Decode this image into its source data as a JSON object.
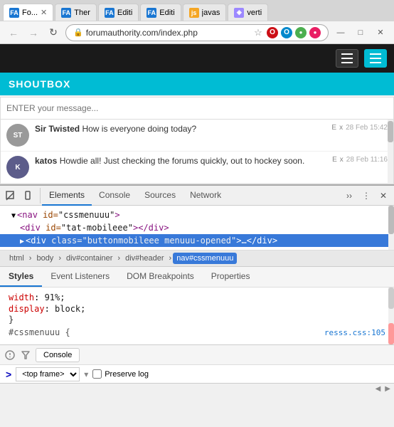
{
  "browser": {
    "tabs": [
      {
        "id": "tab1",
        "favicon": "FA",
        "favicon_style": "fa",
        "label": "Fo...",
        "active": true,
        "closeable": true
      },
      {
        "id": "tab2",
        "favicon": "FA",
        "favicon_style": "fa",
        "label": "Ther",
        "active": false,
        "closeable": false
      },
      {
        "id": "tab3",
        "favicon": "FA",
        "favicon_style": "fa",
        "label": "Editi",
        "active": false,
        "closeable": false
      },
      {
        "id": "tab4",
        "favicon": "FA",
        "favicon_style": "fa",
        "label": "Editi",
        "active": false,
        "closeable": false
      },
      {
        "id": "tab5",
        "favicon": "js",
        "favicon_style": "js",
        "label": "javas",
        "active": false,
        "closeable": false
      },
      {
        "id": "tab6",
        "favicon": "◈",
        "favicon_style": "vert",
        "label": "verti",
        "active": false,
        "closeable": false
      }
    ],
    "address": "forumauthority.com/index.php"
  },
  "site": {
    "header": {
      "hamburger1_label": "≡",
      "hamburger2_label": "≡"
    },
    "shoutbox": {
      "title": "SHOUTBOX",
      "input_placeholder": "ENTER your message...",
      "messages": [
        {
          "id": "msg1",
          "username": "Sir Twisted",
          "text": "How is everyone doing today?",
          "edit": "E",
          "delete": "x",
          "timestamp": "28 Feb 15:42"
        },
        {
          "id": "msg2",
          "username": "katos",
          "text": "Howdie all! Just checking the forums quickly, out to hockey soon.",
          "edit": "E",
          "delete": "x",
          "timestamp": "28 Feb 11:16"
        }
      ]
    }
  },
  "devtools": {
    "toolbar_icons": [
      "cursor-icon",
      "mobile-icon"
    ],
    "tabs": [
      {
        "id": "elements",
        "label": "Elements"
      },
      {
        "id": "console",
        "label": "Console"
      },
      {
        "id": "sources",
        "label": "Sources"
      },
      {
        "id": "network",
        "label": "Network"
      }
    ],
    "active_tab": "elements",
    "dom": {
      "lines": [
        {
          "id": "line1",
          "indent": 0,
          "selected": false,
          "html": "▼<nav id=\"cssmenuuu\">"
        },
        {
          "id": "line2",
          "indent": 1,
          "selected": false,
          "html": "<div id=\"tat-mobileee\"></div>"
        },
        {
          "id": "line3",
          "indent": 1,
          "selected": true,
          "html": "▶<div class=\"buttonmobileee menuuu-opened\">…</div>"
        }
      ]
    },
    "breadcrumb": [
      {
        "id": "bc-html",
        "label": "html"
      },
      {
        "id": "bc-body",
        "label": "body"
      },
      {
        "id": "bc-divcontainer",
        "label": "div#container"
      },
      {
        "id": "bc-divheader",
        "label": "div#header"
      },
      {
        "id": "bc-nav",
        "label": "nav#cssmenuuu",
        "selected": true
      }
    ],
    "styles_tabs": [
      {
        "id": "styles",
        "label": "Styles",
        "active": true
      },
      {
        "id": "event-listeners",
        "label": "Event Listeners"
      },
      {
        "id": "dom-breakpoints",
        "label": "DOM Breakpoints"
      },
      {
        "id": "properties",
        "label": "Properties"
      }
    ],
    "styles_content": {
      "property1": "width",
      "value1": "91%;",
      "property2": "display",
      "value2": "block;",
      "rule_selector": "#cssmenuuu {",
      "rule_source": "resss.css:105",
      "closing_brace": "}"
    },
    "console_bar": {
      "console_label": "Console",
      "filter_icons": [
        "circle-icon",
        "filter-icon"
      ]
    },
    "console_input": {
      "frame_label": "<top frame>",
      "preserve_label": "Preserve log",
      "prompt": ">"
    }
  }
}
